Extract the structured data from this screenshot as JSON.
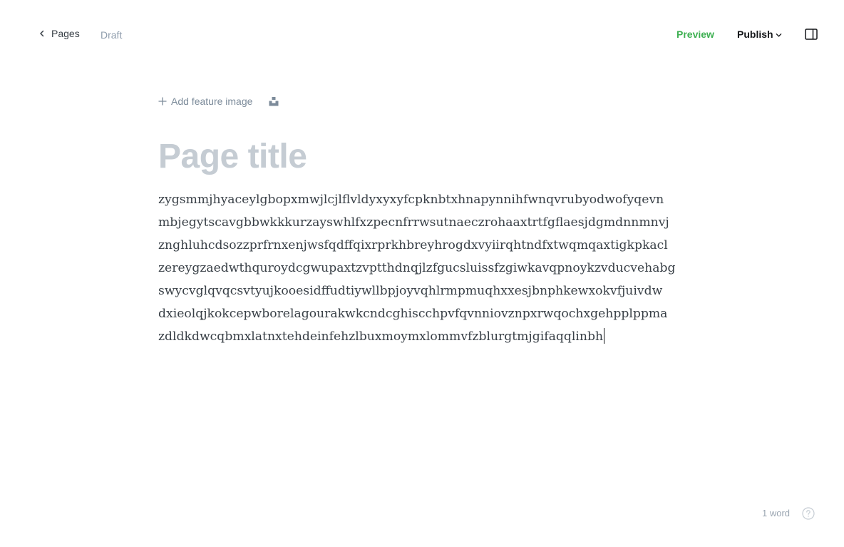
{
  "header": {
    "back_label": "Pages",
    "status": "Draft",
    "preview_label": "Preview",
    "publish_label": "Publish"
  },
  "editor": {
    "add_feature_label": "Add feature image",
    "title_placeholder": "Page title",
    "body_lines": [
      "zygsmmjhyaceylgbopxmwjlcjlflvldyxyxyfcpknbtxhnapynnihfwnqvrubyodwofyqevn",
      "mbjegytscavgbbwkkkurzayswhlfxzpecnfrrwsutnaeczrohaaxtrtfgflaesjdgmdnnmnvj",
      "znghluhcdsozzprfrnxenjwsfqdffqixrprkhbreyhrogdxvyiirqhtndfxtwqmqaxtigkpkacl",
      "zereygzaedwthquroydcgwupaxtzvptthdnqjlzfgucsluissfzgiwkavqpnoykzvducvehabg",
      "swycvglqvqcsvtyujkooesidffudtiywllbpjoyvqhlrmpmuqhxxesjbnphkewxokvfjuivdw",
      "dxieolqjkokcepwborelagourakwkcndcghiscchpvfqvnniovznpxrwqochxgehpplppma",
      "zdldkdwcqbmxlatnxtehdeinfehzlbuxmoymxlommvfzblurgtmjgifaqqlinbh"
    ]
  },
  "footer": {
    "word_count": "1 word"
  },
  "colors": {
    "accent": "#3eb052",
    "muted": "#8e9cac",
    "title_placeholder": "#c5ccd3"
  },
  "icons": {
    "back": "chevron-left-icon",
    "publish_dropdown": "chevron-down-icon",
    "sidebar": "sidebar-toggle-icon",
    "add": "plus-icon",
    "unsplash": "unsplash-icon",
    "help": "help-circle-icon"
  }
}
